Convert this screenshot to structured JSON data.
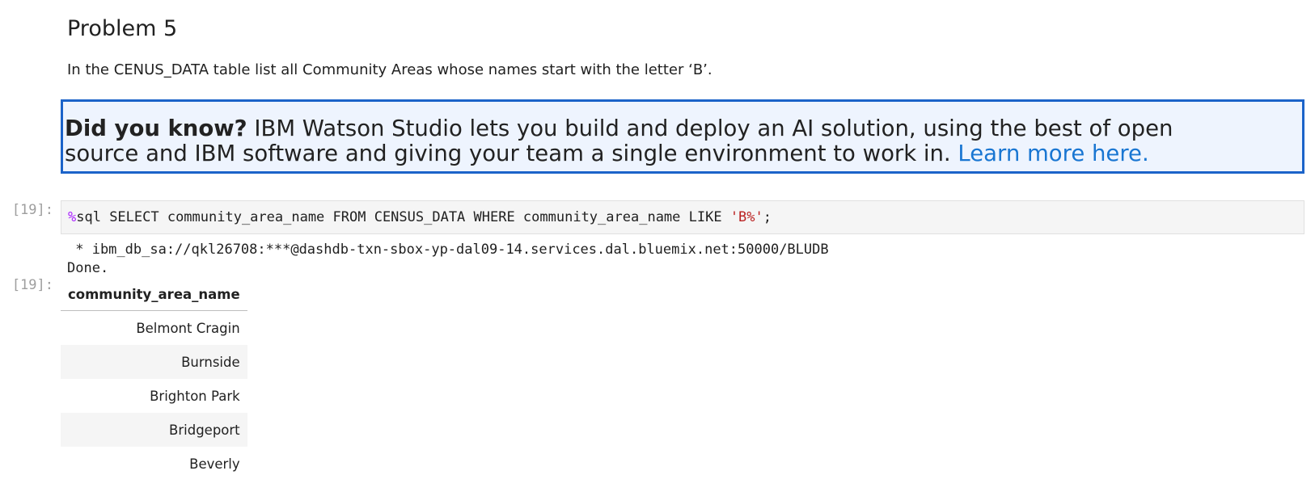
{
  "problem": {
    "heading": "Problem 5",
    "description": "In the CENUS_DATA table list all Community Areas whose names start with the letter ‘B’."
  },
  "callout": {
    "bold_prefix": "Did you know?",
    "text": " IBM Watson Studio lets you build and deploy an AI solution, using the best of open source and IBM software and giving your team a single environment to work in. ",
    "link_text": "Learn more here."
  },
  "code_cell": {
    "prompt": "[19]:",
    "magic": "%",
    "code_main": "sql SELECT community_area_name FROM CENSUS_DATA WHERE community_area_name LIKE ",
    "code_string": "'B%'",
    "code_end": ";"
  },
  "output": {
    "connection_line": " * ibm_db_sa://qkl26708:***@dashdb-txn-sbox-yp-dal09-14.services.dal.bluemix.net:50000/BLUDB",
    "done_line": "Done.",
    "prompt": "[19]:"
  },
  "result_table": {
    "header": "community_area_name",
    "rows": [
      "Belmont Cragin",
      "Burnside",
      "Brighton Park",
      "Bridgeport",
      "Beverly"
    ]
  }
}
